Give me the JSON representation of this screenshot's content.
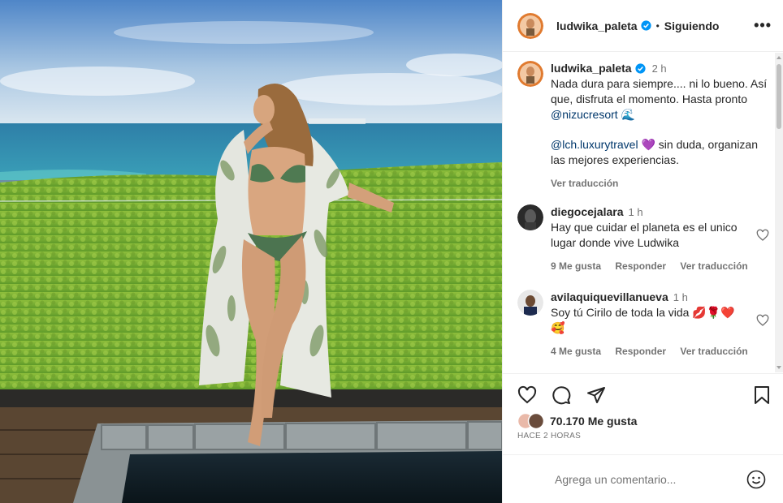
{
  "header": {
    "username": "ludwika_paleta",
    "separator": "•",
    "follow_status": "Siguiendo",
    "more_label": "•••"
  },
  "caption": {
    "username": "ludwika_paleta",
    "time": "2 h",
    "text_part1": "Nada dura para siempre.... ni lo bueno. Así que, disfruta el momento. Hasta pronto ",
    "mention1": "@nizucresort",
    "emoji1": "🌊",
    "mention2": "@lch.luxurytravel",
    "emoji2": "💜",
    "text_part2": " sin duda, organizan las mejores experiencias.",
    "translate": "Ver traducción"
  },
  "comments": [
    {
      "username": "diegocejalara",
      "time": "1 h",
      "text": "Hay que cuidar el planeta es el unico lugar donde vive Ludwika",
      "likes": "9 Me gusta",
      "reply": "Responder",
      "translate": "Ver traducción"
    },
    {
      "username": "avilaquiquevillanueva",
      "time": "1 h",
      "text": "Soy tú Cirilo de toda la vida 💋🌹❤️ 🥰",
      "likes": "4 Me gusta",
      "reply": "Responder",
      "translate": "Ver traducción"
    }
  ],
  "post": {
    "likes": "70.170 Me gusta",
    "posted_ago": "HACE 2 HORAS"
  },
  "add_comment": {
    "placeholder": "Agrega un comentario..."
  },
  "colors": {
    "verified": "#0095f6",
    "link": "#00376b",
    "muted": "#737373"
  }
}
